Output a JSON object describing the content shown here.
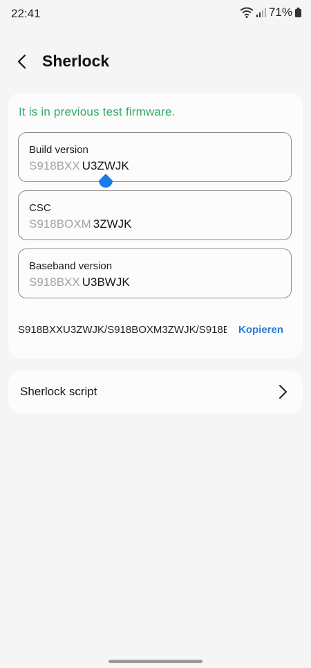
{
  "status_bar": {
    "time": "22:41",
    "battery": "71%"
  },
  "header": {
    "title": "Sherlock"
  },
  "card": {
    "notice": "It is in previous test firmware.",
    "fields": [
      {
        "label": "Build version",
        "value_dim": "S918BXX",
        "value_bright": "U3ZWJK"
      },
      {
        "label": "CSC",
        "value_dim": "S918BOXM",
        "value_bright": "3ZWJK"
      },
      {
        "label": "Baseband version",
        "value_dim": "S918BXX",
        "value_bright": "U3BWJK"
      }
    ],
    "summary": "S918BXXU3ZWJK/S918BOXM3ZWJK/S918B",
    "copy_label": "Kopieren"
  },
  "script_row": {
    "label": "Sherlock script"
  },
  "colors": {
    "notice": "#2eaa63",
    "link": "#2a7bd8",
    "handle": "#1a7ce8"
  }
}
